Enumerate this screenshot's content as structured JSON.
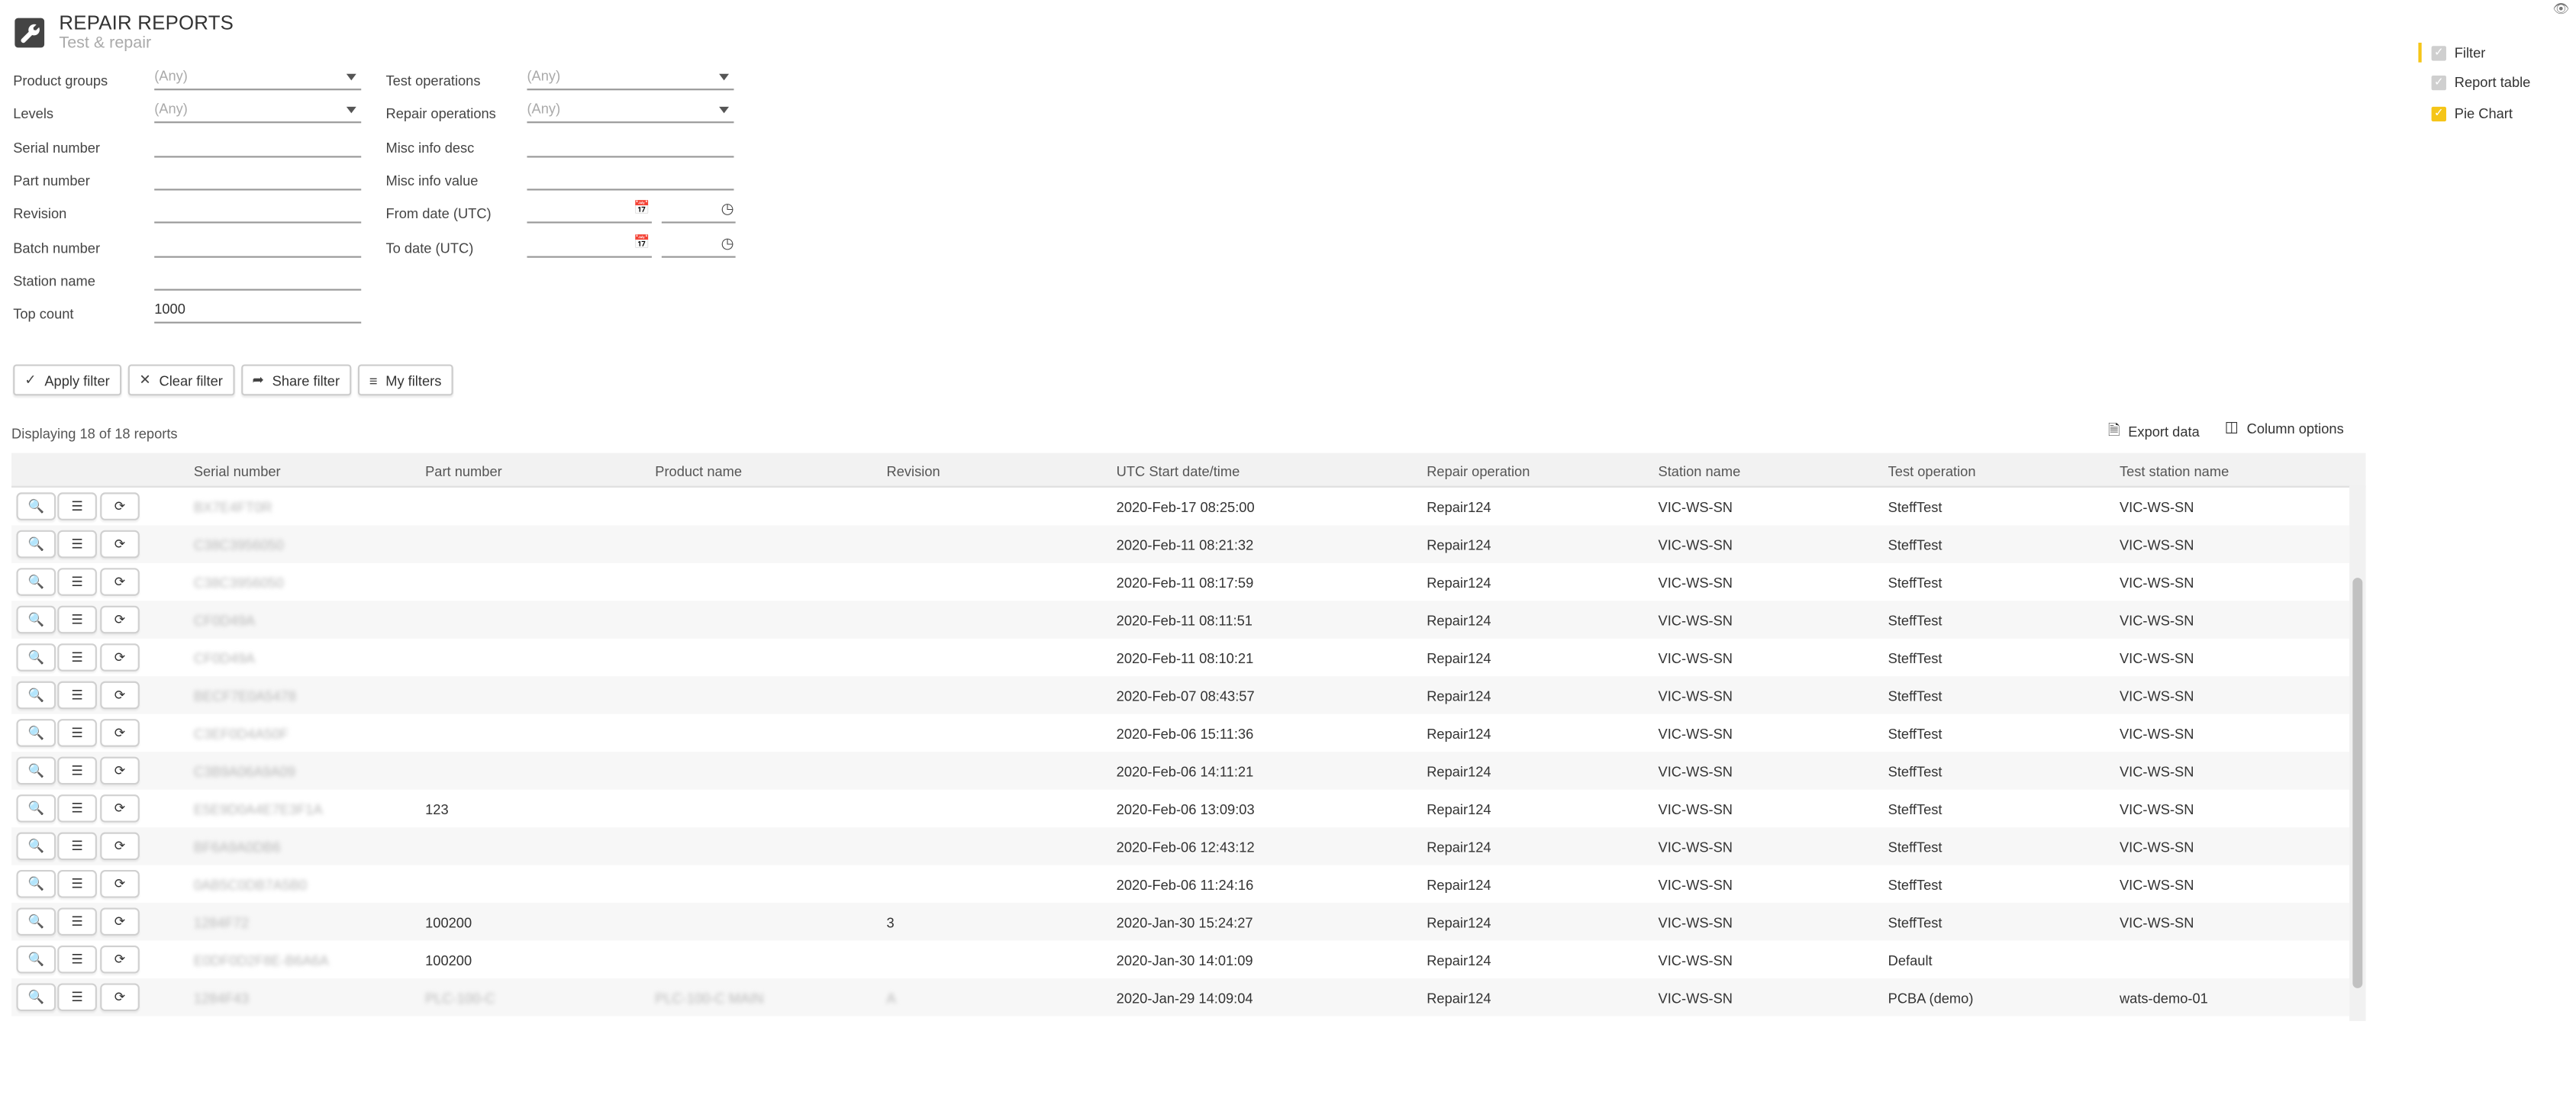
{
  "header": {
    "title": "REPAIR REPORTS",
    "subtitle": "Test & repair"
  },
  "filters": {
    "left": [
      {
        "label": "Product groups",
        "value": "(Any)",
        "type": "select"
      },
      {
        "label": "Levels",
        "value": "(Any)",
        "type": "select"
      },
      {
        "label": "Serial number",
        "value": "",
        "type": "text"
      },
      {
        "label": "Part number",
        "value": "",
        "type": "text"
      },
      {
        "label": "Revision",
        "value": "",
        "type": "text"
      },
      {
        "label": "Batch number",
        "value": "",
        "type": "text"
      },
      {
        "label": "Station name",
        "value": "",
        "type": "text"
      },
      {
        "label": "Top count",
        "value": "1000",
        "type": "text"
      }
    ],
    "right": [
      {
        "label": "Test operations",
        "value": "(Any)",
        "type": "select"
      },
      {
        "label": "Repair operations",
        "value": "(Any)",
        "type": "select"
      },
      {
        "label": "Misc info desc",
        "value": "",
        "type": "text"
      },
      {
        "label": "Misc info value",
        "value": "",
        "type": "text"
      },
      {
        "label": "From date (UTC)",
        "value": "",
        "type": "date"
      },
      {
        "label": "To date (UTC)",
        "value": "",
        "type": "date"
      }
    ]
  },
  "panel": [
    {
      "label": "Filter",
      "checked": true,
      "bar": "#f5c518",
      "box": "#cfcfcf"
    },
    {
      "label": "Report table",
      "checked": true,
      "bar": "transparent",
      "box": "#cfcfcf"
    },
    {
      "label": "Pie Chart",
      "checked": true,
      "bar": "transparent",
      "box": "#f5c518"
    }
  ],
  "buttons": {
    "apply": "Apply filter",
    "clear": "Clear filter",
    "share": "Share filter",
    "my": "My filters"
  },
  "status": "Displaying 18 of 18 reports",
  "toolbar": {
    "export": "Export data",
    "columns": "Column options"
  },
  "table": {
    "columns": [
      "Serial number",
      "Part number",
      "Product name",
      "Revision",
      "UTC Start date/time",
      "Repair operation",
      "Station name",
      "Test operation",
      "Test station name"
    ],
    "rows": [
      {
        "serial": "BX7E4FT0R",
        "part": "",
        "product": "",
        "revision": "",
        "date": "2020-Feb-17 08:25:00",
        "repair": "Repair124",
        "station": "VIC-WS-SN",
        "test": "SteffTest",
        "test_station": "VIC-WS-SN"
      },
      {
        "serial": "C38C3956050",
        "part": "",
        "product": "",
        "revision": "",
        "date": "2020-Feb-11 08:21:32",
        "repair": "Repair124",
        "station": "VIC-WS-SN",
        "test": "SteffTest",
        "test_station": "VIC-WS-SN"
      },
      {
        "serial": "C38C3956050",
        "part": "",
        "product": "",
        "revision": "",
        "date": "2020-Feb-11 08:17:59",
        "repair": "Repair124",
        "station": "VIC-WS-SN",
        "test": "SteffTest",
        "test_station": "VIC-WS-SN"
      },
      {
        "serial": "CF0D49A",
        "part": "",
        "product": "",
        "revision": "",
        "date": "2020-Feb-11 08:11:51",
        "repair": "Repair124",
        "station": "VIC-WS-SN",
        "test": "SteffTest",
        "test_station": "VIC-WS-SN"
      },
      {
        "serial": "CF0D49A",
        "part": "",
        "product": "",
        "revision": "",
        "date": "2020-Feb-11 08:10:21",
        "repair": "Repair124",
        "station": "VIC-WS-SN",
        "test": "SteffTest",
        "test_station": "VIC-WS-SN"
      },
      {
        "serial": "BECF7E0A5478",
        "part": "",
        "product": "",
        "revision": "",
        "date": "2020-Feb-07 08:43:57",
        "repair": "Repair124",
        "station": "VIC-WS-SN",
        "test": "SteffTest",
        "test_station": "VIC-WS-SN"
      },
      {
        "serial": "C3EF0D4A50F",
        "part": "",
        "product": "",
        "revision": "",
        "date": "2020-Feb-06 15:11:36",
        "repair": "Repair124",
        "station": "VIC-WS-SN",
        "test": "SteffTest",
        "test_station": "VIC-WS-SN"
      },
      {
        "serial": "C3B9A06A9A09",
        "part": "",
        "product": "",
        "revision": "",
        "date": "2020-Feb-06 14:11:21",
        "repair": "Repair124",
        "station": "VIC-WS-SN",
        "test": "SteffTest",
        "test_station": "VIC-WS-SN"
      },
      {
        "serial": "E5E9D0A4E7E3F1A",
        "part": "123",
        "product": "",
        "revision": "",
        "date": "2020-Feb-06 13:09:03",
        "repair": "Repair124",
        "station": "VIC-WS-SN",
        "test": "SteffTest",
        "test_station": "VIC-WS-SN"
      },
      {
        "serial": "BF6A9A0DB6",
        "part": "",
        "product": "",
        "revision": "",
        "date": "2020-Feb-06 12:43:12",
        "repair": "Repair124",
        "station": "VIC-WS-SN",
        "test": "SteffTest",
        "test_station": "VIC-WS-SN"
      },
      {
        "serial": "0AB5C0DB7A5B0",
        "part": "",
        "product": "",
        "revision": "",
        "date": "2020-Feb-06 11:24:16",
        "repair": "Repair124",
        "station": "VIC-WS-SN",
        "test": "SteffTest",
        "test_station": "VIC-WS-SN"
      },
      {
        "serial": "1284F72",
        "part": "100200",
        "product": "",
        "revision": "3",
        "date": "2020-Jan-30 15:24:27",
        "repair": "Repair124",
        "station": "VIC-WS-SN",
        "test": "SteffTest",
        "test_station": "VIC-WS-SN"
      },
      {
        "serial": "E0DF0D2F8E-B6A6A",
        "part": "100200",
        "product": "",
        "revision": "",
        "date": "2020-Jan-30 14:01:09",
        "repair": "Repair124",
        "station": "VIC-WS-SN",
        "test": "Default",
        "test_station": ""
      },
      {
        "serial": "1284F43",
        "part": "PLC-100-C",
        "product": "PLC-100-C MAIN",
        "revision": "A",
        "date": "2020-Jan-29 14:09:04",
        "repair": "Repair124",
        "station": "VIC-WS-SN",
        "test": "PCBA (demo)",
        "test_station": "wats-demo-01"
      }
    ]
  }
}
